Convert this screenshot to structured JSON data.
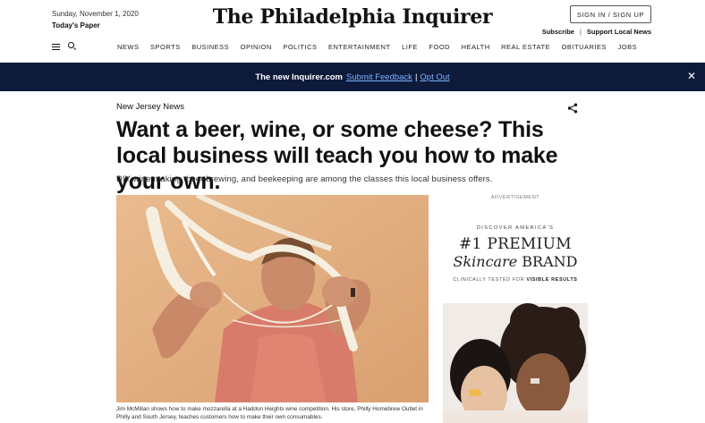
{
  "masthead": {
    "date": "Sunday, November 1, 2020",
    "todays_paper": "Today's Paper",
    "logo": "The Philadelphia Inquirer",
    "sign_in": "SIGN IN / SIGN UP",
    "subscribe": "Subscribe",
    "separator": "|",
    "support": "Support Local News"
  },
  "nav": {
    "items": [
      "NEWS",
      "SPORTS",
      "BUSINESS",
      "OPINION",
      "POLITICS",
      "ENTERTAINMENT",
      "LIFE",
      "FOOD",
      "HEALTH",
      "REAL ESTATE",
      "OBITUARIES",
      "JOBS"
    ]
  },
  "banner": {
    "title": "The new Inquirer.com",
    "feedback_link": "Submit Feedback",
    "separator": "|",
    "opt_out_link": "Opt Out",
    "close": "✕",
    "bg_color": "#0d1a3a",
    "link_color": "#7fb0ff"
  },
  "article": {
    "section": "New Jersey News",
    "headline": "Want a beer, wine, or some cheese? This local business will teach you how to make your own.",
    "dek": "DIY wine making, beer brewing, and beekeeping are among the classes this local business offers.",
    "caption": "Jim McMillan shows how to make mozzarella at a Haddon Heights wine competition. His store, Philly Homebrew Outlet in Philly and South Jersey, teaches customers how to make their own consumables."
  },
  "ad": {
    "label": "ADVERTISEMENT",
    "discover": "DISCOVER AMERICA'S",
    "big": "#1 PREMIUM",
    "brand_italic": "Skincare",
    "brand_rest": " BRAND",
    "clinically": "CLINICALLY TESTED FOR ",
    "visible_results": "VISIBLE RESULTS"
  },
  "icons": {
    "menu": "hamburger-icon",
    "search": "search-icon",
    "share": "share-icon",
    "close": "close-icon"
  }
}
